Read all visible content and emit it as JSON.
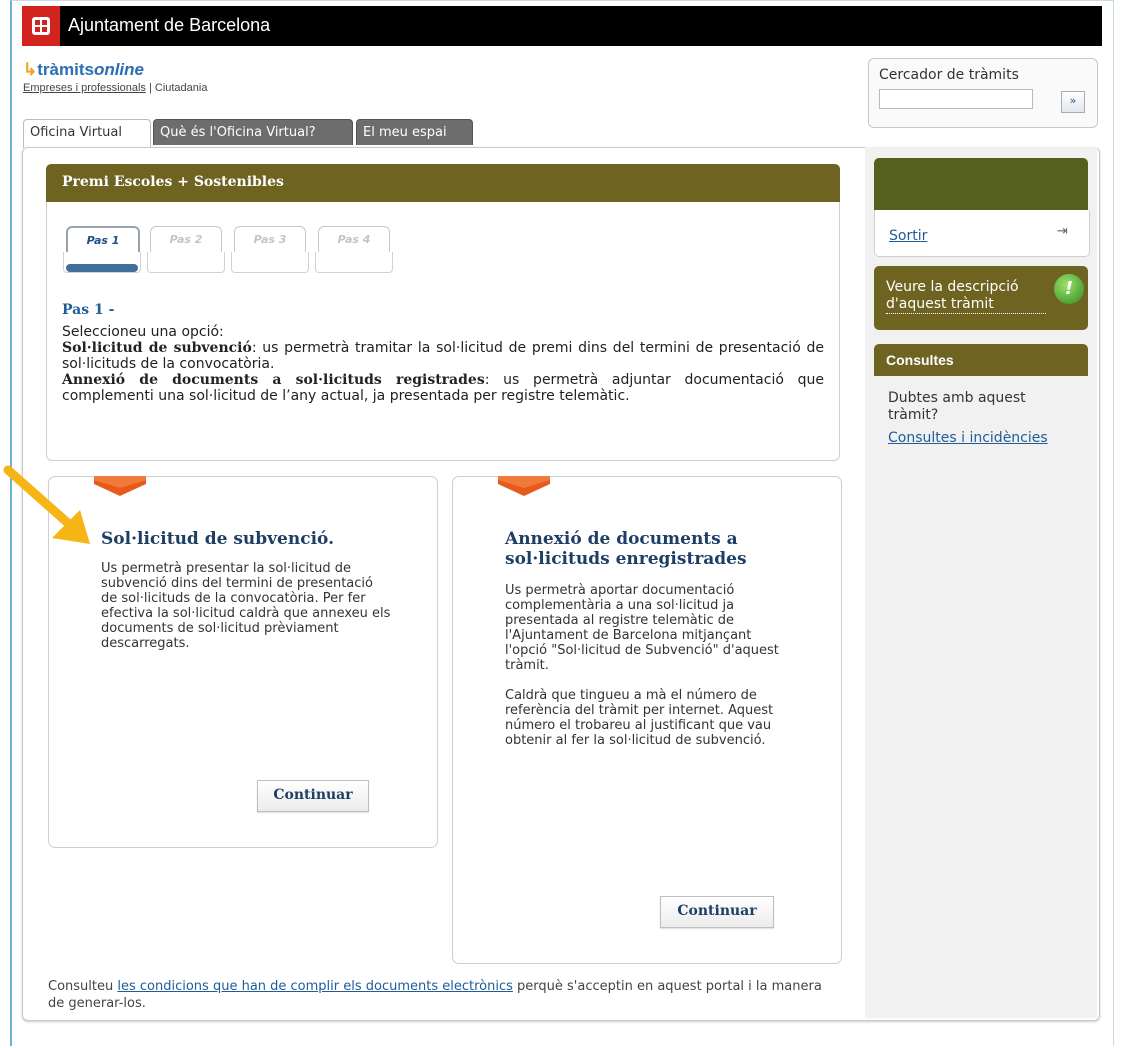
{
  "header": {
    "org_title": "Ajuntament de Barcelona"
  },
  "brand": {
    "name_part1": "tràmits",
    "name_part2": "online",
    "link_business": "Empreses i professionals",
    "separator": "|",
    "link_citizens": "Ciutadania"
  },
  "search": {
    "label": "Cercador de tràmits",
    "value": "",
    "button": "»"
  },
  "tabs": [
    {
      "label": "Oficina Virtual",
      "active": true
    },
    {
      "label": "Què és l'Oficina Virtual?",
      "active": false
    },
    {
      "label": "El meu espai",
      "active": false
    }
  ],
  "procedure": {
    "title": "Premi Escoles + Sostenibles"
  },
  "steps": [
    "Pas 1",
    "Pas 2",
    "Pas 3",
    "Pas 4"
  ],
  "step_heading": "Pas 1 -",
  "intro": {
    "line1": "Seleccioneu una opció:",
    "opt1_bold": "Sol·licitud de subvenció",
    "opt1_text": ": us permetrà tramitar la sol·licitud de premi dins del termini de presentació de sol·licituds de la convocatòria.",
    "opt2_bold": "Annexió de documents a sol·licituds registrades",
    "opt2_text": ": us permetrà adjuntar documentació que complementi una sol·licitud de l’any actual, ja presentada per registre telemàtic."
  },
  "cards": [
    {
      "title": "Sol·licitud de subvenció.",
      "paragraphs": [
        "Us permetrà presentar la sol·licitud de subvenció dins del termini de presentació de sol·licituds de la convocatòria. Per fer efectiva la sol·licitud caldrà que annexeu els documents de sol·licitud prèviament descarregats."
      ],
      "button": "Continuar"
    },
    {
      "title": "Annexió de documents a sol·licituds enregistrades",
      "paragraphs": [
        "Us permetrà aportar documentació complementària a una sol·licitud ja presentada al registre telemàtic de l'Ajuntament de Barcelona mitjançant l'opció \"Sol·licitud de Subvenció\" d'aquest tràmit.",
        "Caldrà que tingueu a mà el número de referència del tràmit per internet. Aquest número el trobareu al justificant que vau obtenir al fer la sol·licitud de subvenció."
      ],
      "button": "Continuar"
    }
  ],
  "footer": {
    "before": "Consulteu ",
    "link": "les condicions que han de complir els documents electrònics",
    "after": " perquè s'acceptin en aquest portal i la manera de generar-los."
  },
  "sidebar": {
    "logout": "Sortir",
    "description_link": "Veure la descripció d'aquest tràmit",
    "description_mark": "!",
    "consultes_title": "Consultes",
    "question": "Dubtes amb aquest tràmit?",
    "consultes_link": "Consultes i incidències"
  },
  "colors": {
    "band": "#6f6322",
    "link": "#1f5c99",
    "flag": "#e85a1c",
    "arrow": "#f5b514"
  }
}
